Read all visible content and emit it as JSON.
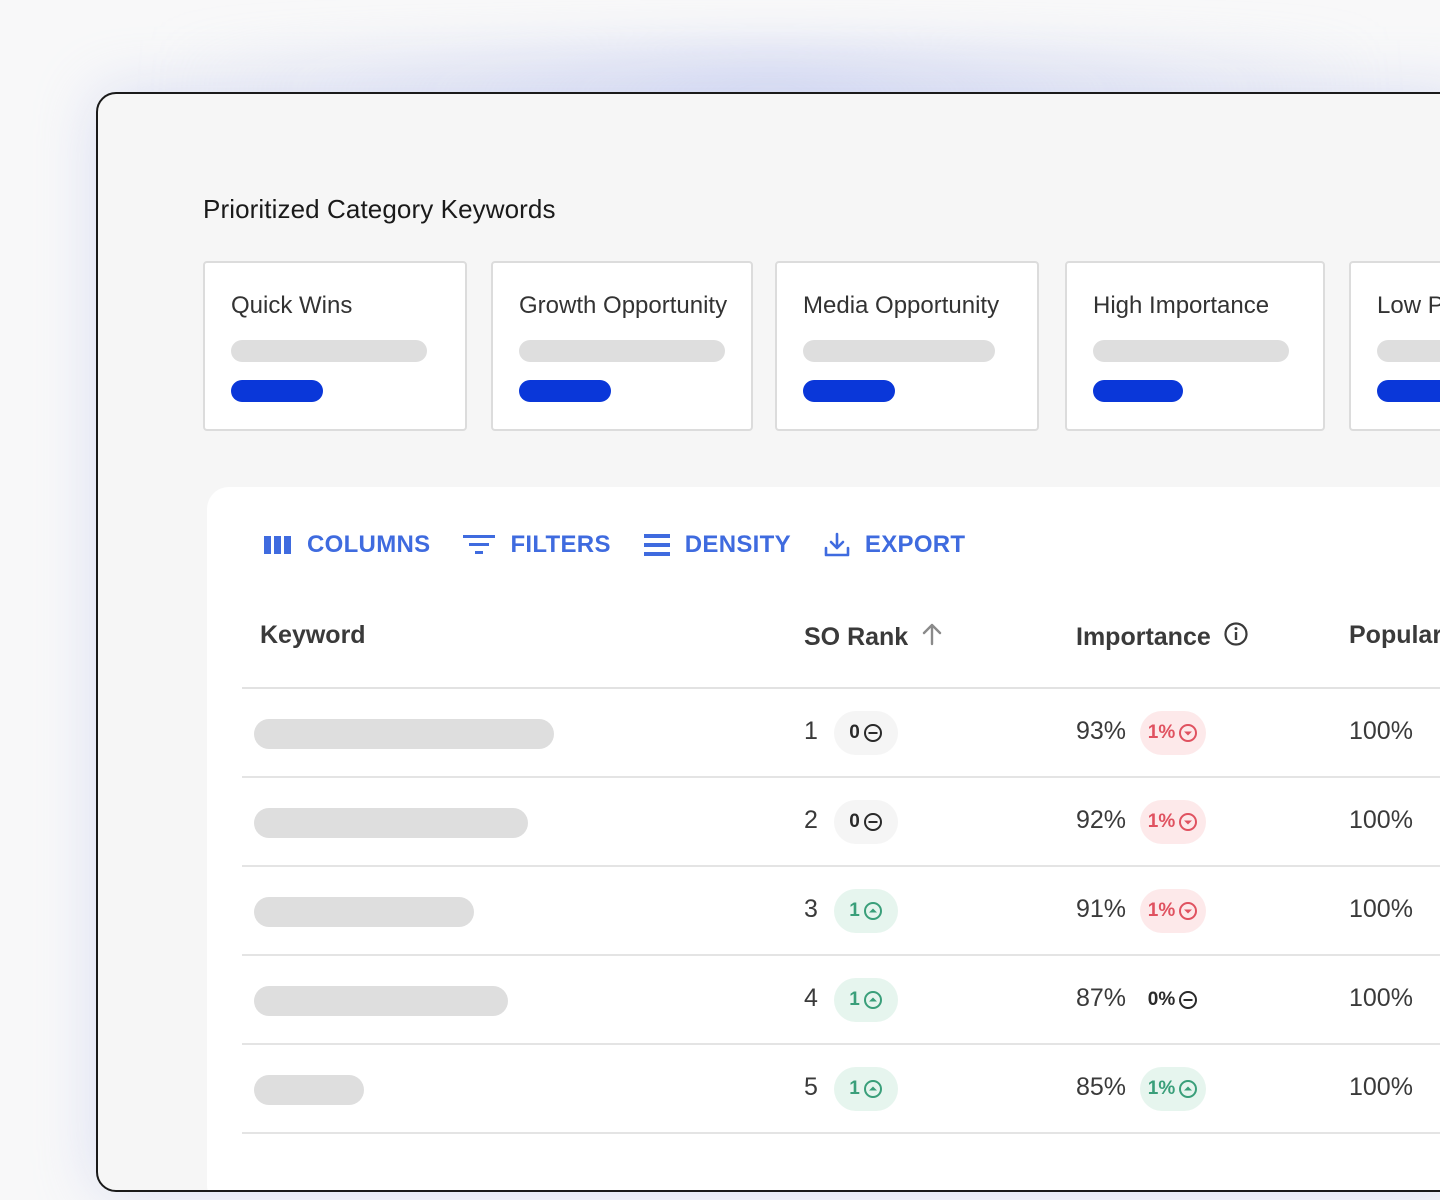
{
  "page": {
    "title": "Prioritized Category Keywords"
  },
  "cards": [
    {
      "label": "Quick Wins"
    },
    {
      "label": "Growth Opportunity"
    },
    {
      "label": "Media Opportunity"
    },
    {
      "label": "High Importance"
    },
    {
      "label": "Low P"
    }
  ],
  "toolbar": {
    "columns_label": "COLUMNS",
    "filters_label": "FILTERS",
    "density_label": "DENSITY",
    "export_label": "EXPORT"
  },
  "table": {
    "headers": {
      "keyword": "Keyword",
      "so_rank": "SO Rank",
      "importance": "Importance",
      "popularity": "Populari"
    },
    "rows": [
      {
        "rank": "1",
        "rank_change": "0",
        "rank_trend": "neutral",
        "importance": "93%",
        "importance_change": "1%",
        "importance_trend": "down",
        "popularity": "100%"
      },
      {
        "rank": "2",
        "rank_change": "0",
        "rank_trend": "neutral",
        "importance": "92%",
        "importance_change": "1%",
        "importance_trend": "down",
        "popularity": "100%"
      },
      {
        "rank": "3",
        "rank_change": "1",
        "rank_trend": "up",
        "importance": "91%",
        "importance_change": "1%",
        "importance_trend": "down",
        "popularity": "100%"
      },
      {
        "rank": "4",
        "rank_change": "1",
        "rank_trend": "up",
        "importance": "87%",
        "importance_change": "0%",
        "importance_trend": "neutral",
        "popularity": "100%"
      },
      {
        "rank": "5",
        "rank_change": "1",
        "rank_trend": "up",
        "importance": "85%",
        "importance_change": "1%",
        "importance_trend": "up",
        "popularity": "100%"
      }
    ]
  },
  "colors": {
    "accent_blue": "#0a37d9",
    "toolbar_blue": "#3f6bdf",
    "trend_up": "#3a9f7a",
    "trend_down": "#e05260"
  },
  "icons": {
    "columns": "columns-icon",
    "filters": "filter-icon",
    "density": "density-icon",
    "export": "export-icon",
    "sort": "arrow-up-icon",
    "info": "info-icon",
    "trend_neutral": "minus-circle-icon",
    "trend_up": "up-circle-icon",
    "trend_down": "down-circle-icon"
  }
}
